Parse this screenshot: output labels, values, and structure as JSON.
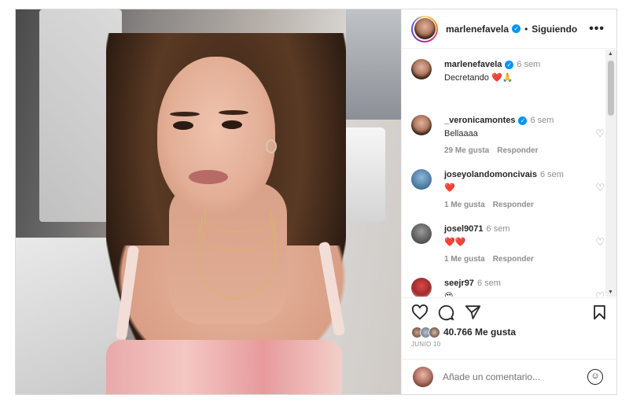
{
  "post": {
    "author": "marlenefavela",
    "follow_state": "Siguiendo",
    "separator": "•",
    "more_label": "•••"
  },
  "caption": {
    "user": "marlenefavela",
    "time": "6 sem",
    "text": "Decretando",
    "emojis": "❤️🙏"
  },
  "comments": [
    {
      "user": "_veronicamontes",
      "verified": true,
      "time": "6 sem",
      "text": "Bellaaaa",
      "likes": "29 Me gusta",
      "reply": "Responder"
    },
    {
      "user": "joseyolandomoncivais",
      "verified": false,
      "time": "6 sem",
      "text": "❤️",
      "likes": "1 Me gusta",
      "reply": "Responder"
    },
    {
      "user": "josel9071",
      "verified": false,
      "time": "6 sem",
      "text": "❤️❤️",
      "likes": "1 Me gusta",
      "reply": "Responder"
    },
    {
      "user": "seejr97",
      "verified": false,
      "time": "6 sem",
      "text": "😍",
      "likes": "",
      "reply": ""
    }
  ],
  "actions": {
    "like_icon": "heart-icon",
    "comment_icon": "comment-icon",
    "share_icon": "share-icon",
    "save_icon": "bookmark-icon"
  },
  "stats": {
    "likes": "40.766 Me gusta",
    "date": "JUNIO 10"
  },
  "composer": {
    "placeholder": "Añade un comentario..."
  },
  "colors": {
    "verified": "#0095f6",
    "heart": "#ed4956",
    "muted": "#8e8e8e"
  }
}
